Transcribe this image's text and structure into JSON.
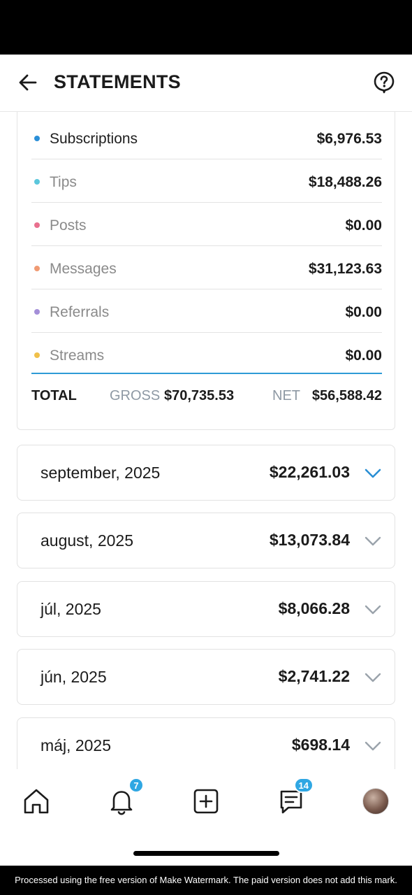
{
  "header": {
    "title": "STATEMENTS"
  },
  "categories": [
    {
      "label": "Subscriptions",
      "value": "$6,976.53",
      "dot_color": "#2b8fd8"
    },
    {
      "label": "Tips",
      "value": "$18,488.26",
      "dot_color": "#5bc7dc"
    },
    {
      "label": "Posts",
      "value": "$0.00",
      "dot_color": "#e9708e"
    },
    {
      "label": "Messages",
      "value": "$31,123.63",
      "dot_color": "#f09a73"
    },
    {
      "label": "Referrals",
      "value": "$0.00",
      "dot_color": "#a48fd8"
    },
    {
      "label": "Streams",
      "value": "$0.00",
      "dot_color": "#f0c04a"
    }
  ],
  "totals": {
    "label": "TOTAL",
    "gross_label": "GROSS",
    "gross_value": "$70,735.53",
    "net_label": "NET",
    "net_value": "$56,588.42"
  },
  "months": [
    {
      "label": "september, 2025",
      "value": "$22,261.03",
      "active": true
    },
    {
      "label": "august, 2025",
      "value": "$13,073.84",
      "active": false
    },
    {
      "label": "júl, 2025",
      "value": "$8,066.28",
      "active": false
    },
    {
      "label": "jún, 2025",
      "value": "$2,741.22",
      "active": false
    },
    {
      "label": "máj, 2025",
      "value": "$698.14",
      "active": false
    }
  ],
  "tab_bar": {
    "notifications_badge": "7",
    "messages_badge": "14"
  },
  "colors": {
    "accent": "#2fa7e3",
    "text": "#1b1b1b",
    "muted": "#8e99a4"
  },
  "watermark": {
    "text": "Processed using the free version of Make Watermark. The paid version does not add this mark."
  }
}
